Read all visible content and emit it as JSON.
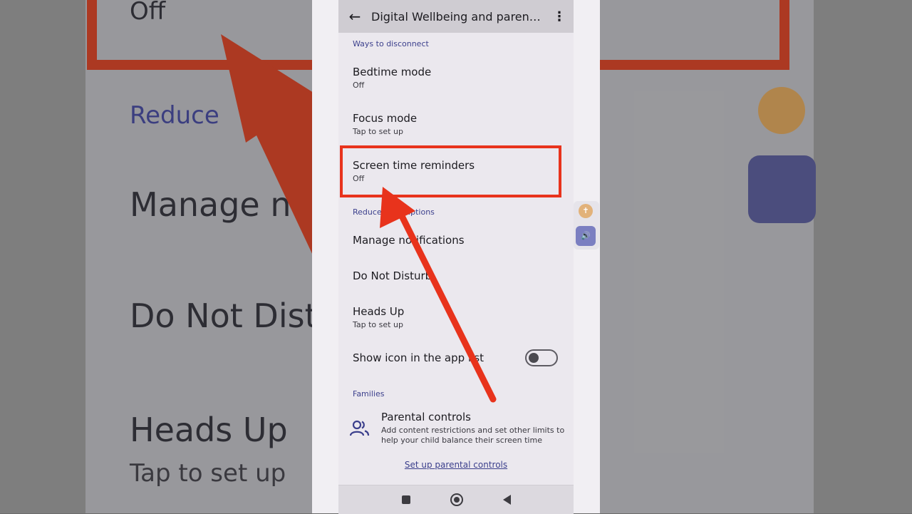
{
  "app": {
    "title": "Digital Wellbeing and parental...",
    "back_icon": "arrow-left-icon",
    "more_icon": "more-vert-icon"
  },
  "sections": {
    "ways": "Ways to disconnect",
    "reduce": "Reduce interruptions",
    "families": "Families"
  },
  "items": {
    "bedtime": {
      "title": "Bedtime mode",
      "sub": "Off"
    },
    "focus": {
      "title": "Focus mode",
      "sub": "Tap to set up"
    },
    "screen_time": {
      "title": "Screen time reminders",
      "sub": "Off"
    },
    "manage_notifications": {
      "title": "Manage notifications"
    },
    "dnd": {
      "title": "Do Not Disturb"
    },
    "heads_up": {
      "title": "Heads Up",
      "sub": "Tap to set up"
    },
    "show_icon": {
      "title": "Show icon in the app list",
      "toggle_on": false
    }
  },
  "parental": {
    "title": "Parental controls",
    "desc": "Add content restrictions and set other limits to help your child balance their screen time",
    "link": "Set up parental controls",
    "icon": "people-icon"
  },
  "background_zoom": {
    "off": "Off",
    "reduce": "Reduce",
    "manage": "Manage no",
    "dnd": "Do Not Dist",
    "heads_up": "Heads Up",
    "tap": "Tap to set up"
  },
  "colors": {
    "highlight": "#e8331c",
    "accent": "#3b3f8c"
  }
}
